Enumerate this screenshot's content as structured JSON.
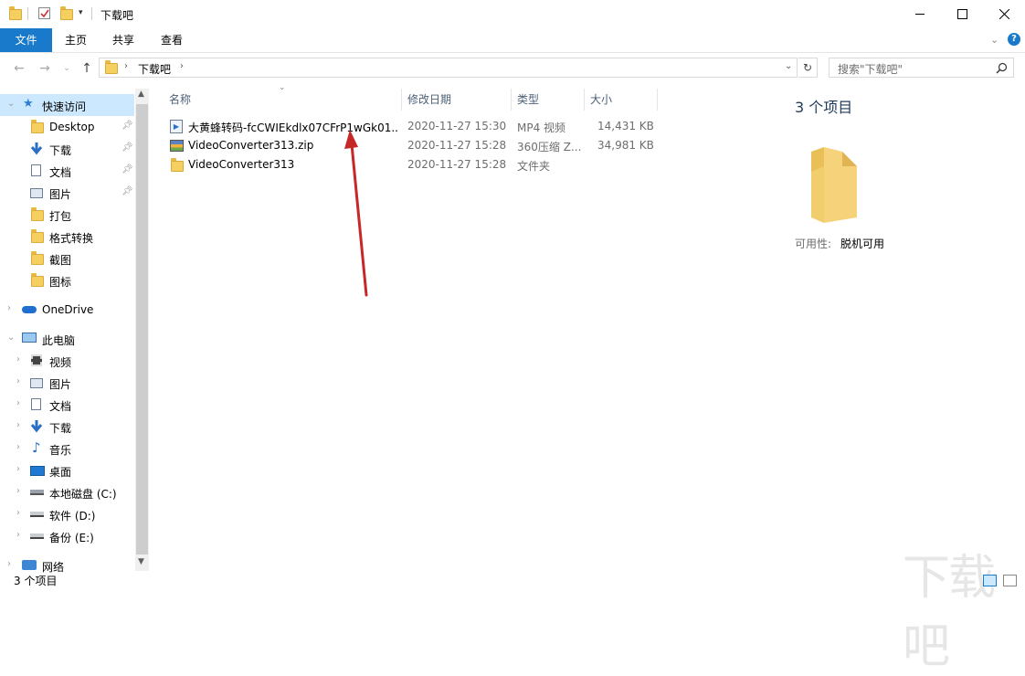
{
  "window": {
    "title": "下载吧"
  },
  "ribbon": {
    "tabs": [
      {
        "label": "文件",
        "active": true
      },
      {
        "label": "主页"
      },
      {
        "label": "共享"
      },
      {
        "label": "查看"
      }
    ]
  },
  "address": {
    "path": [
      "下载吧"
    ],
    "search_placeholder": "搜索\"下载吧\""
  },
  "nav": {
    "quick_access": "快速访问",
    "quick_items": [
      "Desktop",
      "下载",
      "文档",
      "图片",
      "打包",
      "格式转换",
      "截图",
      "图标"
    ],
    "onedrive": "OneDrive",
    "this_pc": "此电脑",
    "pc_items": [
      "视频",
      "图片",
      "文档",
      "下载",
      "音乐",
      "桌面",
      "本地磁盘 (C:)",
      "软件 (D:)",
      "备份 (E:)"
    ],
    "network": "网络"
  },
  "columns": {
    "name": "名称",
    "modified": "修改日期",
    "type": "类型",
    "size": "大小"
  },
  "files": [
    {
      "name": "大黄蜂转码-fcCWIEkdlx07CFrP1wGk01...",
      "modified": "2020-11-27 15:30",
      "type": "MP4 视频",
      "size": "14,431 KB",
      "icon": "video-file-icon"
    },
    {
      "name": "VideoConverter313.zip",
      "modified": "2020-11-27 15:28",
      "type": "360压缩 Z...",
      "size": "34,981 KB",
      "icon": "zip-archive-icon"
    },
    {
      "name": "VideoConverter313",
      "modified": "2020-11-27 15:28",
      "type": "文件夹",
      "size": "",
      "icon": "folder-icon"
    }
  ],
  "details": {
    "count": "3 个项目",
    "availability_label": "可用性:",
    "availability_value": "脱机可用"
  },
  "status": {
    "items": "3 个项目"
  },
  "watermark": "下载吧",
  "colors": {
    "accent": "#1979ca",
    "selected": "#cce8ff",
    "folder": "#f5cf5f",
    "arrow": "#d42a2a"
  }
}
